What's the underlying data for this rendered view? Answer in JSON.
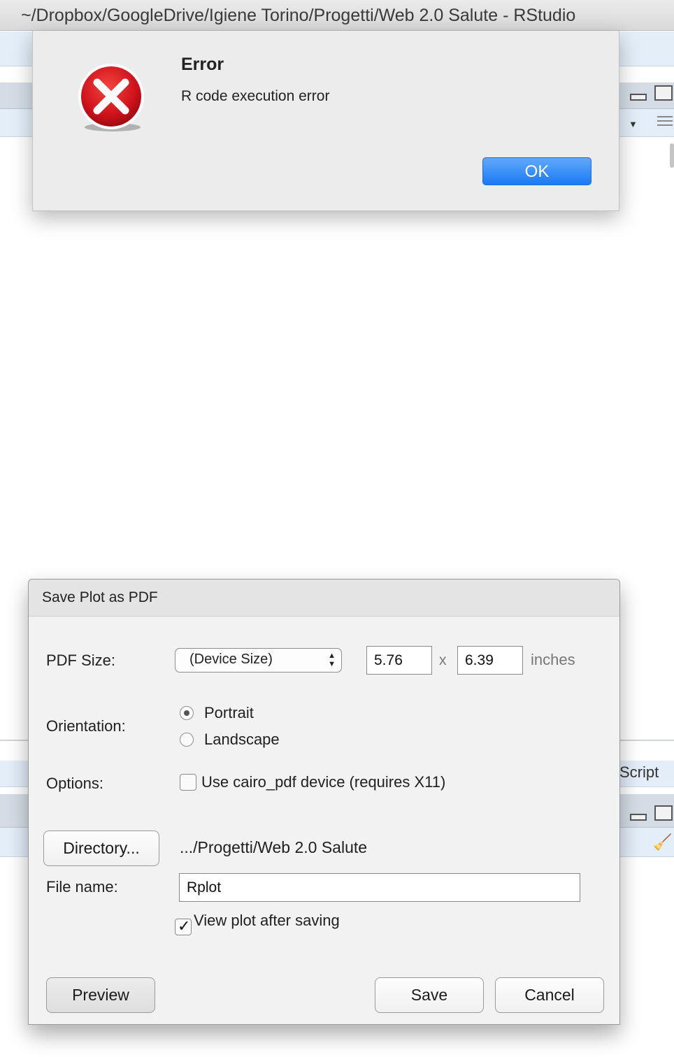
{
  "window": {
    "title": "~/Dropbox/GoogleDrive/Igiene Torino/Progetti/Web 2.0 Salute - RStudio"
  },
  "background": {
    "script_label": "Script"
  },
  "error_dialog": {
    "icon": "error-x-icon",
    "title": "Error",
    "message": "R code execution error",
    "ok_label": "OK",
    "accent_color": "#1b7af3",
    "icon_color": "#d0121b"
  },
  "save_dialog": {
    "title": "Save Plot as PDF",
    "pdf_size_label": "PDF Size:",
    "pdf_size_selected": "(Device Size)",
    "width_value": "5.76",
    "height_value": "6.39",
    "times_sign": "x",
    "units": "inches",
    "orientation_label": "Orientation:",
    "orientation_options": [
      "Portrait",
      "Landscape"
    ],
    "orientation_selected": "Portrait",
    "options_label": "Options:",
    "cairo_option": "Use cairo_pdf device (requires X11)",
    "cairo_checked": false,
    "directory_button": "Directory...",
    "directory_path": ".../Progetti/Web 2.0 Salute",
    "file_name_label": "File name:",
    "file_name_value": "Rplot",
    "view_after_saving": "View plot after saving",
    "view_after_saving_checked": true,
    "preview_button": "Preview",
    "save_button": "Save",
    "cancel_button": "Cancel"
  }
}
